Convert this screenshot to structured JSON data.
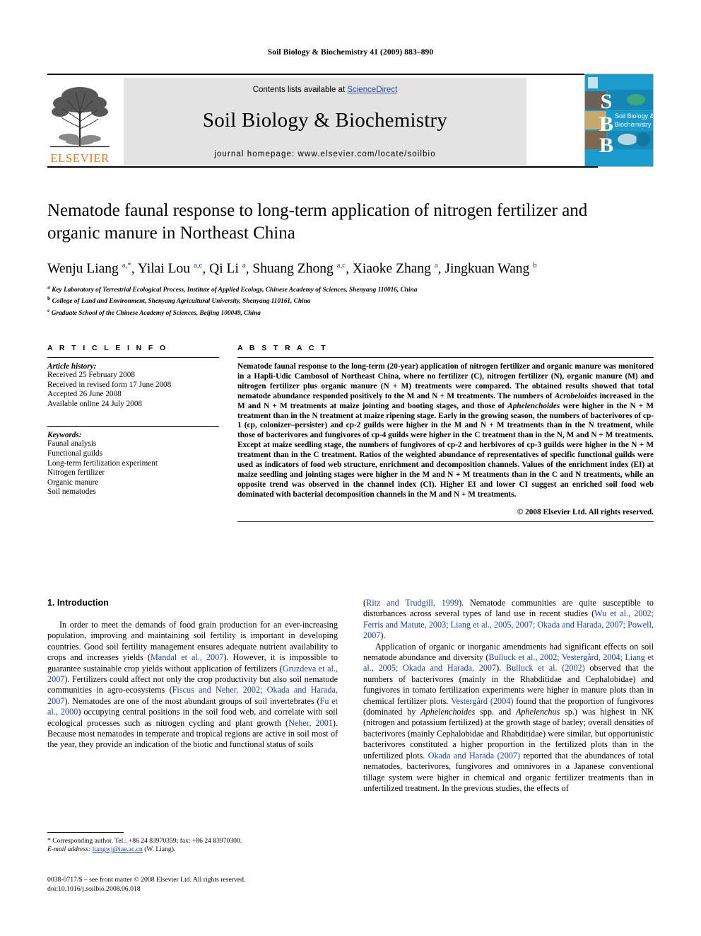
{
  "running_head": "Soil Biology & Biochemistry 41 (2009) 883–890",
  "masthead": {
    "publisher_name": "ELSEVIER",
    "contents_prefix": "Contents lists available at ",
    "sciencedirect": "ScienceDirect",
    "journal_title": "Soil Biology & Biochemistry",
    "homepage": "journal homepage: www.elsevier.com/locate/soilbio",
    "cover": {
      "letters": [
        "S",
        "B",
        "B"
      ],
      "title_line1": "Soil Biology &",
      "title_line2": "Biochemistry",
      "bg_color": "#1a9ccf"
    }
  },
  "article": {
    "title": "Nematode faunal response to long-term application of nitrogen fertilizer and organic manure in Northeast China",
    "authors_html": "Wenju Liang <sup>a,*</sup>, Yilai Lou <sup>a,c</sup>, Qi Li <sup>a</sup>, Shuang Zhong <sup>a,c</sup>, Xiaoke Zhang <sup>a</sup>, Jingkuan Wang <sup>b</sup>",
    "affiliations": [
      "a Key Laboratory of Terrestrial Ecological Process, Institute of Applied Ecology, Chinese Academy of Sciences, Shenyang 110016, China",
      "b College of Land and Environment, Shenyang Agricultural University, Shenyang 110161, China",
      "c Graduate School of the Chinese Academy of Sciences, Beijing 100049, China"
    ]
  },
  "article_info": {
    "heading": "A R T I C L E   I N F O",
    "history_label": "Article history:",
    "history": [
      "Received 25 February 2008",
      "Received in revised form 17 June 2008",
      "Accepted 26 June 2008",
      "Available online 24 July 2008"
    ],
    "keywords_label": "Keywords:",
    "keywords": [
      "Faunal analysis",
      "Functional guilds",
      "Long-term fertilization experiment",
      "Nitrogen fertilizer",
      "Organic manure",
      "Soil nematodes"
    ]
  },
  "abstract": {
    "heading": "A B S T R A C T",
    "text_html": "Nematode faunal response to the long-term (20-year) application of nitrogen fertilizer and organic manure was monitored in a Hapli-Udic Cambosol of Northeast China, where no fertilizer (C), nitrogen fertilizer (N), organic manure (M) and nitrogen fertilizer plus organic manure (N + M) treatments were compared. The obtained results showed that total nematode abundance responded positively to the M and N + M treatments. The numbers of <i>Acrobeloides</i> increased in the M and N + M treatments at maize jointing and booting stages, and those of <i>Aphelenchoides</i> were higher in the N + M treatment than in the N treatment at maize ripening stage. Early in the growing season, the numbers of bacterivores of cp-1 (cp, colonizer–persister) and cp-2 guilds were higher in the M and N + M treatments than in the N treatment, while those of bacterivores and fungivores of cp-4 guilds were higher in the C treatment than in the N, M and N + M treatments. Except at maize seedling stage, the numbers of fungivores of cp-2 and herbivores of cp-3 guilds were higher in the N + M treatment than in the C treatment. Ratios of the weighted abundance of representatives of specific functional guilds were used as indicators of food web structure, enrichment and decomposition channels. Values of the enrichment index (EI) at maize seedling and jointing stages were higher in the M and N + M treatments than in the C and N treatments, while an opposite trend was observed in the channel index (CI). Higher EI and lower CI suggest an enriched soil food web dominated with bacterial decomposition channels in the M and N + M treatments.",
    "copyright": "© 2008 Elsevier Ltd. All rights reserved."
  },
  "introduction": {
    "heading": "1.  Introduction",
    "left_paragraph_html": "In order to meet the demands of food grain production for an ever-increasing population, improving and maintaining soil fertility is important in developing countries. Good soil fertility management ensures adequate nutrient availability to crops and increases yields (<span class=\"cite\">Mandal et al., 2007</span>). However, it is impossible to guarantee sustainable crop yields without application of fertilizers (<span class=\"cite\">Gruzdeva et al., 2007</span>). Fertilizers could affect not only the crop productivity but also soil nematode communities in agro-ecosystems (<span class=\"cite\">Fiscus and Neher, 2002; Okada and Harada, 2007</span>). Nematodes are one of the most abundant groups of soil invertebrates (<span class=\"cite\">Fu et al., 2000</span>) occupying central positions in the soil food web, and correlate with soil ecological processes such as nitrogen cycling and plant growth (<span class=\"cite\">Neher, 2001</span>). Because most nematodes in temperate and tropical regions are active in soil most of the year, they provide an indication of the biotic and functional status of soils",
    "right_paragraph_1_html": "(<span class=\"cite\">Ritz and Trudgill, 1999</span>). Nematode communities are quite susceptible to disturbances across several types of land use in recent studies (<span class=\"cite\">Wu et al., 2002; Ferris and Matute, 2003; Liang et al., 2005, 2007; Okada and Harada, 2007; Powell, 2007</span>).",
    "right_paragraph_2_html": "Application of organic or inorganic amendments had significant effects on soil nematode abundance and diversity (<span class=\"cite\">Bulluck et al., 2002; Vestergård, 2004; Liang et al., 2005; Okada and Harada, 2007</span>). <span class=\"cite\">Bulluck et al. (2002)</span> observed that the numbers of bacterivores (mainly in the Rhabditidae and Cephalobidae) and fungivores in tomato fertilization experiments were higher in manure plots than in chemical fertilizer plots. <span class=\"cite\">Vestergård (2004)</span> found that the proportion of fungivores (dominated by <i>Aphelenchoides</i> spp. and <i>Aphelenchus</i> sp.) was highest in NK (nitrogen and potassium fertilized) at the growth stage of barley; overall densities of bacterivores (mainly Cephalobidae and Rhabditidae) were similar, but opportunistic bacterivores constituted a higher proportion in the fertilized plots than in the unfertilized plots. <span class=\"cite\">Okada and Harada (2007)</span> reported that the abundances of total nematodes, bacterivores, fungivores and omnivores in a Japanese conventional tillage system were higher in chemical and organic fertilizer treatments than in unfertilized treatment. In the previous studies, the effects of"
  },
  "footnote": {
    "corresponding_html": "* Corresponding author. Tel.: +86 24 83970359; fax: +86 24 83970300.",
    "email_label": "E-mail address:",
    "email": "liangwj@iae.ac.cn",
    "email_suffix": "(W. Liang)."
  },
  "bottom_matter": {
    "front_matter": "0038-0717/$ – see front matter © 2008 Elsevier Ltd. All rights reserved.",
    "doi": "doi:10.1016/j.soilbio.2008.06.018"
  }
}
